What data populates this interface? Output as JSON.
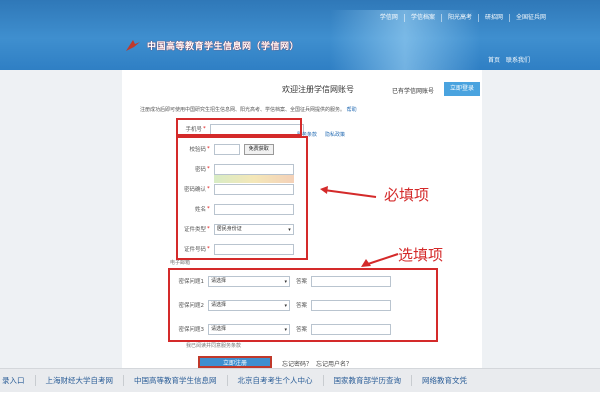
{
  "header": {
    "top_links": [
      "学信网",
      "学信档案",
      "阳光高考",
      "研招网",
      "全国征兵网"
    ],
    "logo_text": "中国高等教育学生信息网（学信网）",
    "right_links": [
      "首页",
      "联系我们"
    ]
  },
  "form": {
    "title": "欢迎注册学信网账号",
    "have_account": "已有学信网账号",
    "login_button": "立即登录",
    "intro": "注册成功后即可使用中国研究生招生信息网、阳光高考、学信档案、全国征兵网提供的服务。",
    "intro_link": "帮助",
    "required_fields": [
      {
        "label": "手机号",
        "required": true
      },
      {
        "label": "校验码",
        "required": true,
        "button": "免费获取"
      },
      {
        "label": "密码",
        "required": true
      },
      {
        "label": "密码确认",
        "required": true
      },
      {
        "label": "姓名",
        "required": true
      },
      {
        "label": "证件类型",
        "required": true,
        "value": "居民身份证"
      },
      {
        "label": "证件号码",
        "required": true
      }
    ],
    "terms_links": [
      "服务条款",
      "隐私政策"
    ],
    "email_label": "电子邮箱",
    "security_questions": [
      {
        "label": "密保问题1",
        "select": "请选择",
        "answer_label": "答案"
      },
      {
        "label": "密保问题2",
        "select": "请选择",
        "answer_label": "答案"
      },
      {
        "label": "密保问题3",
        "select": "请选择",
        "answer_label": "答案"
      }
    ],
    "agree_text": "我已阅读并同意服务条款",
    "submit_label": "立即注册",
    "after_links": [
      "忘记密码？",
      "忘记用户名？"
    ]
  },
  "annotations": {
    "required_label": "必填项",
    "optional_label": "选填项",
    "accent": "#d42a2a"
  },
  "bottom_links": [
    "录入口",
    "上海财经大学自考网",
    "中国高等教育学生信息网",
    "北京自考考生个人中心",
    "国家教育部学历查询",
    "网络教育文凭"
  ]
}
